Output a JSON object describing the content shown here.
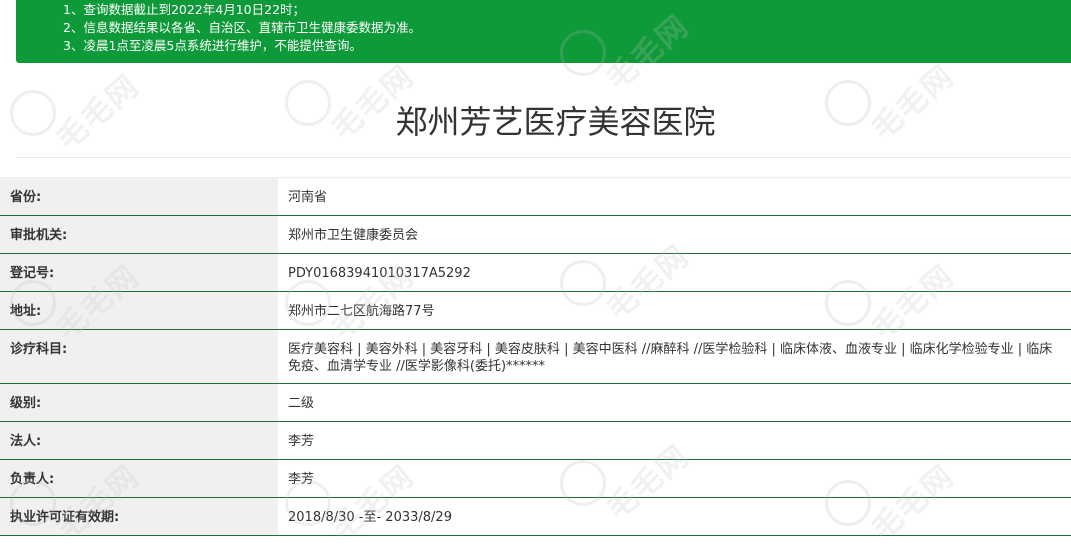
{
  "notice": {
    "line1": "1、查询数据截止到2022年4月10日22时；",
    "line2": "2、信息数据结果以各省、自治区、直辖市卫生健康委数据为准。",
    "line3": "3、凌晨1点至凌晨5点系统进行维护，不能提供查询。"
  },
  "hospital_name": "郑州芳艺医疗美容医院",
  "rows": [
    {
      "label": "省份:",
      "value": "河南省"
    },
    {
      "label": "审批机关:",
      "value": "郑州市卫生健康委员会"
    },
    {
      "label": "登记号:",
      "value": "PDY01683941010317A5292"
    },
    {
      "label": "地址:",
      "value": "郑州市二七区航海路77号"
    },
    {
      "label": "诊疗科目:",
      "value": "医疗美容科 | 美容外科 | 美容牙科 | 美容皮肤科 | 美容中医科 //麻醉科 //医学检验科 | 临床体液、血液专业 | 临床化学检验专业 | 临床免疫、血清学专业 //医学影像科(委托)******"
    },
    {
      "label": "级别:",
      "value": "二级"
    },
    {
      "label": "法人:",
      "value": "李芳"
    },
    {
      "label": "负责人:",
      "value": "李芳"
    },
    {
      "label": "执业许可证有效期:",
      "value": "2018/8/30 -至- 2033/8/29"
    }
  ],
  "watermark": {
    "text": "毛毛网"
  },
  "colors": {
    "notice_bg": "#0f9a3a",
    "row_rule": "#1f6b3d",
    "label_bg": "#f0f0f0"
  }
}
